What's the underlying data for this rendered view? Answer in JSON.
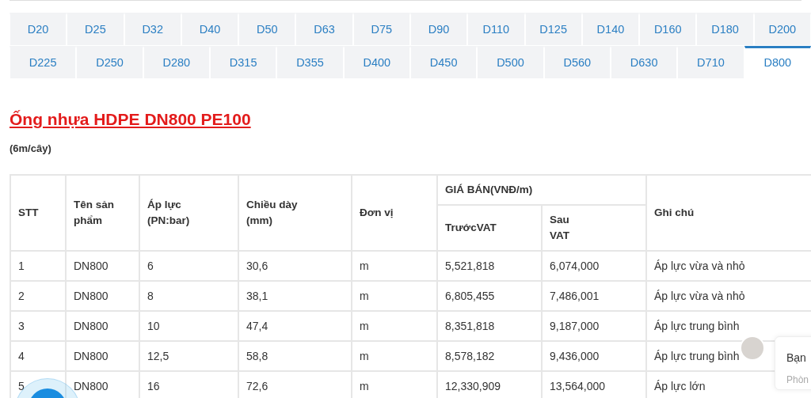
{
  "tab_rows": [
    {
      "tabs": [
        {
          "label": "D20",
          "selected": false
        },
        {
          "label": "D25",
          "selected": false
        },
        {
          "label": "D32",
          "selected": false
        },
        {
          "label": "D40",
          "selected": false
        },
        {
          "label": "D50",
          "selected": false
        },
        {
          "label": "D63",
          "selected": false
        },
        {
          "label": "D75",
          "selected": false
        },
        {
          "label": "D90",
          "selected": false
        },
        {
          "label": "D110",
          "selected": false
        },
        {
          "label": "D125",
          "selected": false
        },
        {
          "label": "D140",
          "selected": false
        },
        {
          "label": "D160",
          "selected": false
        },
        {
          "label": "D180",
          "selected": false
        },
        {
          "label": "D200",
          "selected": false
        }
      ]
    },
    {
      "tabs": [
        {
          "label": "D225",
          "selected": false
        },
        {
          "label": "D250",
          "selected": false
        },
        {
          "label": "D280",
          "selected": false
        },
        {
          "label": "D315",
          "selected": false
        },
        {
          "label": "D355",
          "selected": false
        },
        {
          "label": "D400",
          "selected": false
        },
        {
          "label": "D450",
          "selected": false
        },
        {
          "label": "D500",
          "selected": false
        },
        {
          "label": "D560",
          "selected": false
        },
        {
          "label": "D630",
          "selected": false
        },
        {
          "label": "D710",
          "selected": false
        },
        {
          "label": "D800",
          "selected": true
        }
      ]
    }
  ],
  "title": "Ống nhựa HDPE DN800 PE100",
  "subtitle": "(6m/cây)",
  "table": {
    "columns": [
      "STT",
      "Tên sản\nphẩm",
      "Áp lực\n(PN:bar)",
      "Chiều dày\n(mm)",
      "Đơn vị"
    ],
    "price_group": {
      "label": "GIÁ BÁN(VNĐ/m)",
      "columns": [
        "TrướcVAT",
        "Sau\nVAT"
      ]
    },
    "last_column": "Ghi chú",
    "rows": [
      [
        "1",
        "DN800",
        "6",
        "30,6",
        "m",
        "5,521,818",
        "6,074,000",
        "Áp lực vừa và nhỏ"
      ],
      [
        "2",
        "DN800",
        "8",
        "38,1",
        "m",
        "6,805,455",
        "7,486,001",
        "Áp lực vừa và nhỏ"
      ],
      [
        "3",
        "DN800",
        "10",
        "47,4",
        "m",
        "8,351,818",
        "9,187,000",
        "Áp lực trung bình"
      ],
      [
        "4",
        "DN800",
        "12,5",
        "58,8",
        "m",
        "8,578,182",
        "9,436,000",
        "Áp lực trung bình"
      ],
      [
        "5",
        "DN800",
        "16",
        "72,6",
        "m",
        "12,330,909",
        "13,564,000",
        "Áp lực lớn"
      ]
    ]
  },
  "chat_widget": {
    "message": "Bạn",
    "subtext": "Phòn"
  }
}
